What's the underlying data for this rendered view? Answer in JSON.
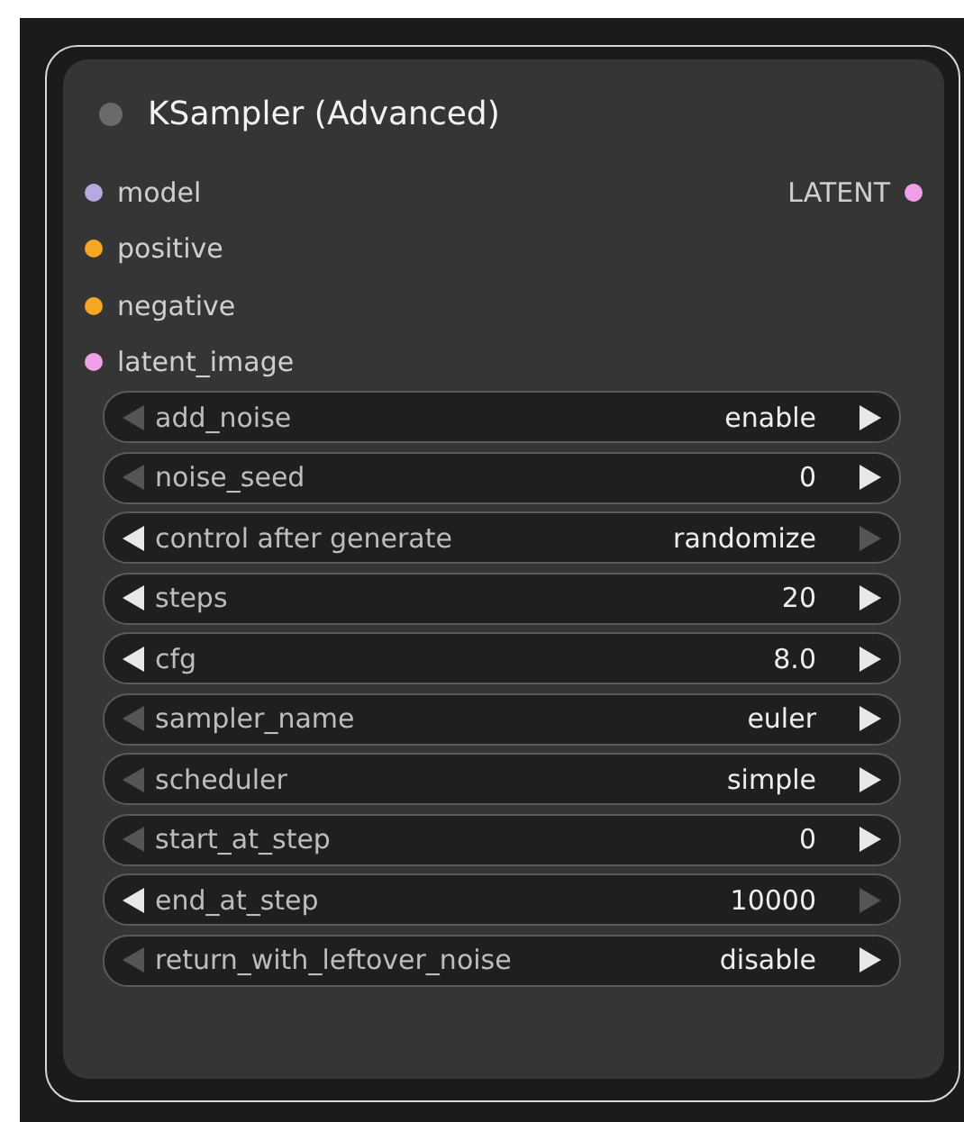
{
  "node": {
    "title": "KSampler (Advanced)",
    "inputs": [
      {
        "name": "model",
        "color": "#b7a9e0"
      },
      {
        "name": "positive",
        "color": "#f5a623"
      },
      {
        "name": "negative",
        "color": "#f5a623"
      },
      {
        "name": "latent_image",
        "color": "#f0a0e8"
      }
    ],
    "outputs": [
      {
        "name": "LATENT",
        "color": "#f0a0e8"
      }
    ],
    "widgets": [
      {
        "label": "add_noise",
        "value": "enable",
        "decrement_enabled": false,
        "increment_enabled": true
      },
      {
        "label": "noise_seed",
        "value": "0",
        "decrement_enabled": false,
        "increment_enabled": true
      },
      {
        "label": "control after generate",
        "value": "randomize",
        "decrement_enabled": true,
        "increment_enabled": false
      },
      {
        "label": "steps",
        "value": "20",
        "decrement_enabled": true,
        "increment_enabled": true
      },
      {
        "label": "cfg",
        "value": "8.0",
        "decrement_enabled": true,
        "increment_enabled": true
      },
      {
        "label": "sampler_name",
        "value": "euler",
        "decrement_enabled": false,
        "increment_enabled": true
      },
      {
        "label": "scheduler",
        "value": "simple",
        "decrement_enabled": false,
        "increment_enabled": true
      },
      {
        "label": "start_at_step",
        "value": "0",
        "decrement_enabled": false,
        "increment_enabled": true
      },
      {
        "label": "end_at_step",
        "value": "10000",
        "decrement_enabled": true,
        "increment_enabled": false
      },
      {
        "label": "return_with_leftover_noise",
        "value": "disable",
        "decrement_enabled": false,
        "increment_enabled": true
      }
    ]
  }
}
